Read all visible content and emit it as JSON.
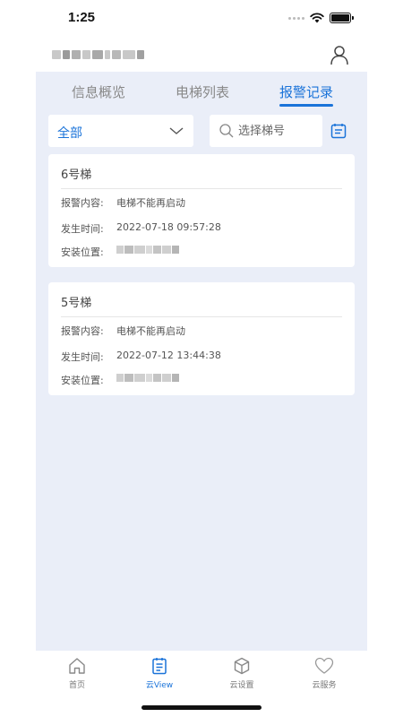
{
  "status_bar": {
    "time": "1:25"
  },
  "tabs": [
    {
      "label": "信息概览",
      "active": false
    },
    {
      "label": "电梯列表",
      "active": false
    },
    {
      "label": "报警记录",
      "active": true
    }
  ],
  "filter": {
    "selected": "全部",
    "search_placeholder": "选择梯号"
  },
  "labels": {
    "alarm_content": "报警内容:",
    "occur_time": "发生时间:",
    "install_location": "安装位置:"
  },
  "alarms": [
    {
      "elevator": "6号梯",
      "content": "电梯不能再启动",
      "time": "2022-07-18 09:57:28"
    },
    {
      "elevator": "5号梯",
      "content": "电梯不能再启动",
      "time": "2022-07-12 13:44:38"
    }
  ],
  "bottom_nav": [
    {
      "label": "首页",
      "icon": "home-icon",
      "active": false
    },
    {
      "label": "云View",
      "icon": "clipboard-icon",
      "active": true
    },
    {
      "label": "云设置",
      "icon": "cube-icon",
      "active": false
    },
    {
      "label": "云服务",
      "icon": "heart-icon",
      "active": false
    }
  ],
  "colors": {
    "accent": "#1a73d9",
    "background": "#eaeef8",
    "card": "#ffffff"
  }
}
